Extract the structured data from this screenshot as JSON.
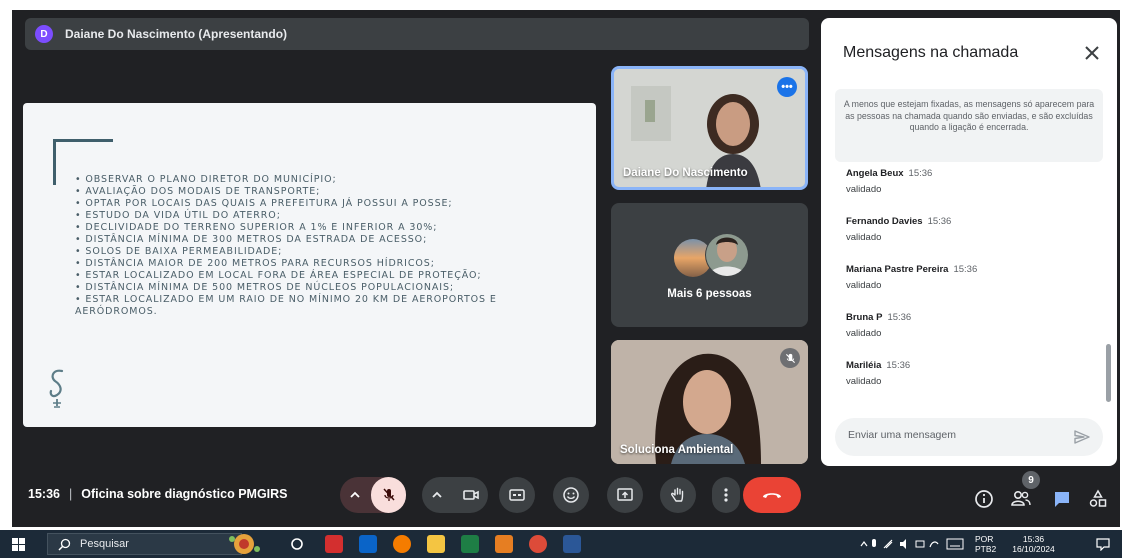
{
  "presenter": {
    "initial": "D",
    "label": "Daiane Do Nascimento (Apresentando)"
  },
  "slide": {
    "bullets": [
      "• OBSERVAR O PLANO DIRETOR DO MUNICÍPIO;",
      "• AVALIAÇÃO DOS MODAIS DE TRANSPORTE;",
      "• OPTAR POR LOCAIS DAS QUAIS A PREFEITURA JÁ POSSUI A POSSE;",
      "• ESTUDO DA VIDA ÚTIL DO ATERRO;",
      "• DECLIVIDADE DO TERRENO SUPERIOR A 1% E INFERIOR A 30%;",
      "• DISTÂNCIA MÍNIMA DE 300 METROS DA ESTRADA DE ACESSO;",
      "• SOLOS DE BAIXA PERMEABILIDADE;",
      "• DISTÂNCIA MAIOR DE 200 METROS PARA RECURSOS HÍDRICOS;",
      "• ESTAR LOCALIZADO EM LOCAL FORA DE ÁREA ESPECIAL DE PROTEÇÃO;",
      "• DISTÂNCIA MÍNIMA DE 500 METROS DE NÚCLEOS POPULACIONAIS;",
      "• ESTAR LOCALIZADO EM UM RAIO DE NO MÍNIMO 20 KM DE AEROPORTOS E AERÓDROMOS."
    ]
  },
  "tiles": {
    "t1_name": "Daiane Do Nascimento",
    "t2_label": "Mais 6 pessoas",
    "t3_name": "Soluciona Ambiental"
  },
  "chat": {
    "title": "Mensagens na chamada",
    "notice": "A menos que estejam fixadas, as mensagens só aparecem para as pessoas na chamada quando são enviadas, e são excluídas quando a ligação é encerrada.",
    "messages": [
      {
        "sender": "Angela Beux",
        "time": "15:36",
        "text": "validado"
      },
      {
        "sender": "Fernando Davies",
        "time": "15:36",
        "text": "validado"
      },
      {
        "sender": "Mariana Pastre Pereira",
        "time": "15:36",
        "text": "validado"
      },
      {
        "sender": "Bruna P",
        "time": "15:36",
        "text": "validado"
      },
      {
        "sender": "Mariléia",
        "time": "15:36",
        "text": "validado"
      }
    ],
    "input_placeholder": "Enviar uma mensagem"
  },
  "bottom": {
    "time": "15:36",
    "separator": "|",
    "meeting_name": "Oficina sobre diagnóstico PMGIRS",
    "people_count": "9"
  },
  "taskbar": {
    "search_placeholder": "Pesquisar",
    "lang_top": "POR",
    "lang_bottom": "PTB2",
    "clock_time": "15:36",
    "clock_date": "16/10/2024"
  },
  "colors": {
    "background": "#202124",
    "hangup": "#ea4335",
    "accent": "#8ab4f8",
    "chat_icon": "#8ab4f8",
    "taskbar": "#1c2a38"
  }
}
